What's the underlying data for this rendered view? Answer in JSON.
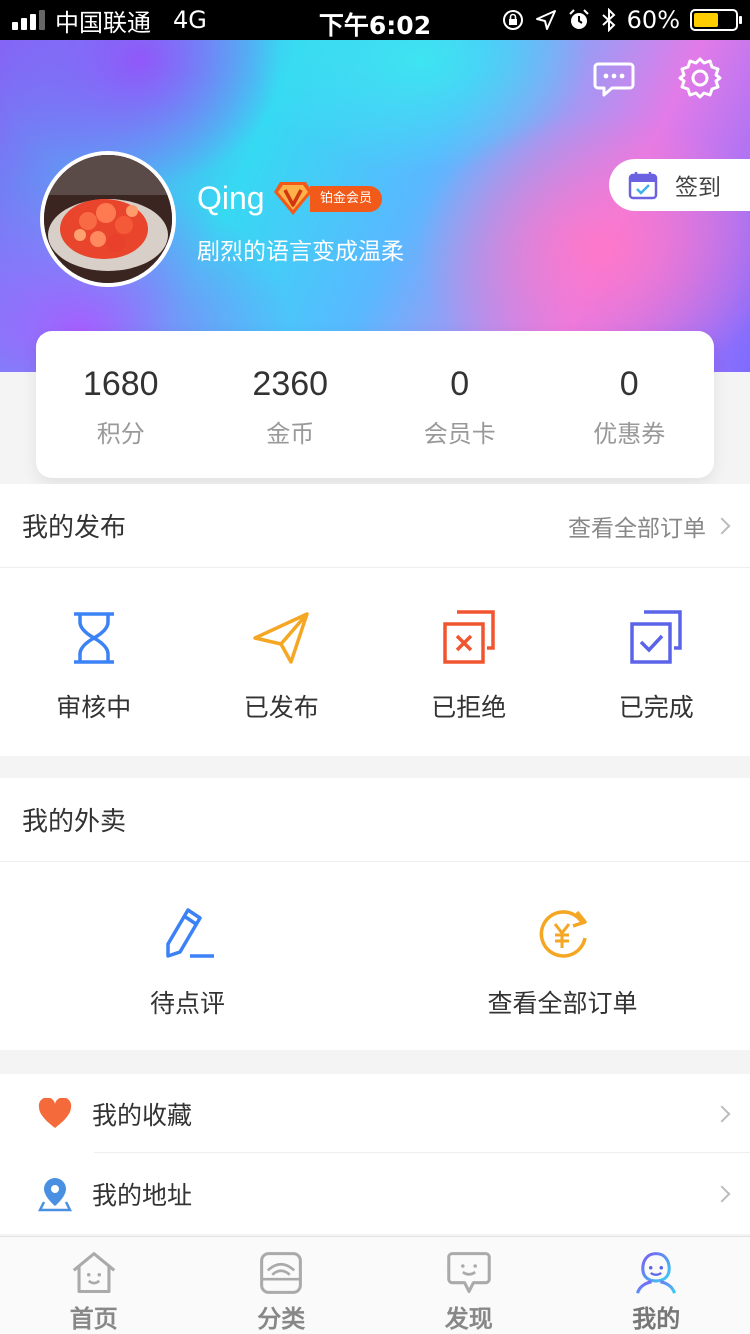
{
  "status_bar": {
    "carrier": "中国联通",
    "network": "4G",
    "time": "下午6:02",
    "battery_percent": "60%"
  },
  "header": {
    "message_icon": "chat-bubble-icon",
    "settings_icon": "gear-icon"
  },
  "profile": {
    "username": "Qing",
    "vip_level_label": "铂金会员",
    "motto": "剧烈的语言变成温柔",
    "checkin_label": "签到"
  },
  "stats": [
    {
      "value": "1680",
      "label": "积分"
    },
    {
      "value": "2360",
      "label": "金币"
    },
    {
      "value": "0",
      "label": "会员卡"
    },
    {
      "value": "0",
      "label": "优惠券"
    }
  ],
  "publish_section": {
    "title": "我的发布",
    "link": "查看全部订单",
    "items": [
      {
        "label": "审核中",
        "icon": "hourglass-icon"
      },
      {
        "label": "已发布",
        "icon": "paper-plane-icon"
      },
      {
        "label": "已拒绝",
        "icon": "rejected-copy-icon"
      },
      {
        "label": "已完成",
        "icon": "completed-copy-icon"
      }
    ]
  },
  "takeout_section": {
    "title": "我的外卖",
    "items": [
      {
        "label": "待点评",
        "icon": "pencil-icon"
      },
      {
        "label": "查看全部订单",
        "icon": "yuan-refresh-icon"
      }
    ]
  },
  "menu_list": [
    {
      "label": "我的收藏",
      "icon": "heart-icon"
    },
    {
      "label": "我的地址",
      "icon": "location-pin-icon"
    }
  ],
  "tab_bar": [
    {
      "label": "首页",
      "icon": "home-icon"
    },
    {
      "label": "分类",
      "icon": "category-icon"
    },
    {
      "label": "发现",
      "icon": "discover-icon"
    },
    {
      "label": "我的",
      "icon": "profile-icon",
      "active": true
    }
  ],
  "colors": {
    "vip_orange": "#f25a1a",
    "blue": "#3b82f6",
    "orange": "#f5a623",
    "red": "#f0552f",
    "indigo": "#5b63e8",
    "heart": "#f56a3a"
  }
}
